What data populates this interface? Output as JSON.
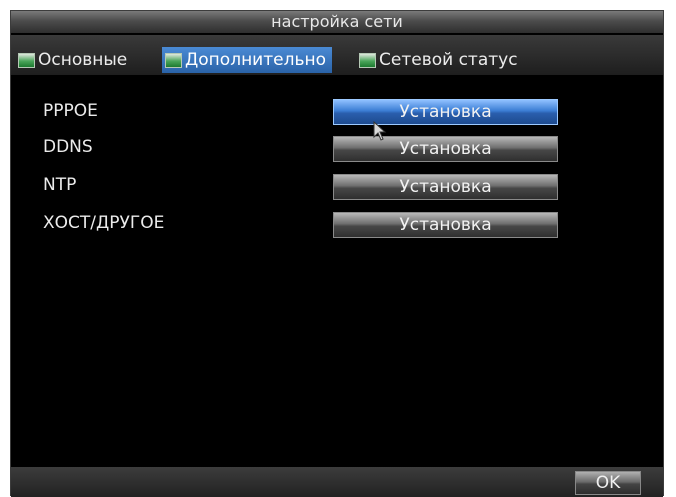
{
  "window": {
    "title": "настройка сети"
  },
  "tabs": [
    {
      "label": "Основные",
      "icon": "tab-image-icon",
      "active": false
    },
    {
      "label": "Дополнительно",
      "icon": "tab-image-icon",
      "active": true
    },
    {
      "label": "Сетевой статус",
      "icon": "tab-image-icon",
      "active": false
    }
  ],
  "settings": [
    {
      "label": "PPPOE",
      "button_label": "Установка",
      "focused": true
    },
    {
      "label": "DDNS",
      "button_label": "Установка",
      "focused": false
    },
    {
      "label": "NTP",
      "button_label": "Установка",
      "focused": false
    },
    {
      "label": "ХОСТ/ДРУГОЕ",
      "button_label": "Установка",
      "focused": false
    }
  ],
  "footer": {
    "ok_label": "OK"
  },
  "colors": {
    "background": "#000000",
    "active_accent": "#2a63a8",
    "text": "#ebebeb"
  }
}
